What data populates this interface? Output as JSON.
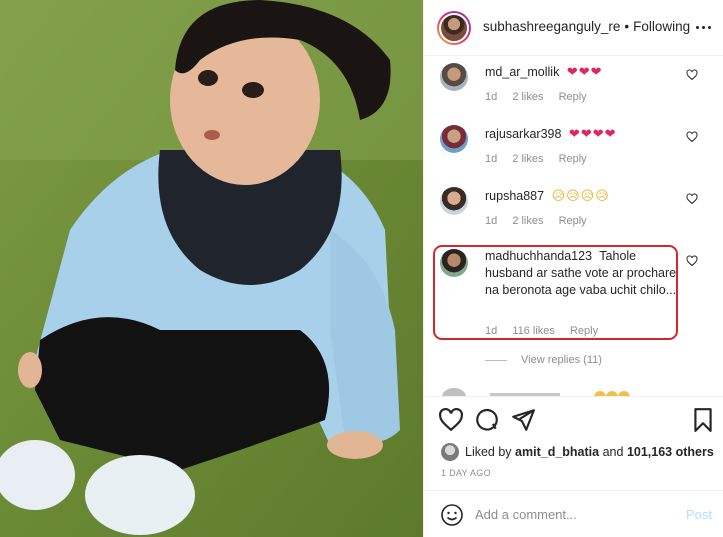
{
  "header": {
    "username": "subhashreeganguly_re",
    "separator": "•",
    "follow_status": "Following",
    "more_icon": "more-horizontal-icon"
  },
  "comments": [
    {
      "username": "md_ar_mollik",
      "emoji": "❤❤❤",
      "time": "1d",
      "likes": "2 likes",
      "reply": "Reply"
    },
    {
      "username": "rajusarkar398",
      "emoji": "❤❤❤❤",
      "time": "1d",
      "likes": "2 likes",
      "reply": "Reply"
    },
    {
      "username": "rupsha887",
      "emoji": "😥😥😥😥",
      "time": "1d",
      "likes": "2 likes",
      "reply": "Reply"
    },
    {
      "username": "madhuchhanda123",
      "text": "Tahole husband ar sathe vote ar prochare na beronota age vaba uchit chilo...",
      "time": "1d",
      "likes": "116 likes",
      "reply": "Reply"
    }
  ],
  "view_replies": "View replies (11)",
  "actions": {
    "like_icon": "heart-outline-icon",
    "comment_icon": "comment-bubble-icon",
    "share_icon": "paper-plane-icon",
    "save_icon": "bookmark-icon"
  },
  "likes": {
    "prefix": "Liked by",
    "user": "amit_d_bhatia",
    "middle": "and",
    "count": "101,163 others"
  },
  "post_date": "1 DAY AGO",
  "add_comment": {
    "placeholder": "Add a comment...",
    "post_label": "Post",
    "emoji_icon": "smiley-icon"
  },
  "colors": {
    "highlight_border": "#d0282f",
    "heart_emoji": "#e0245e",
    "muted_text": "#8e8e8e",
    "post_button_disabled": "#b2dffc"
  }
}
